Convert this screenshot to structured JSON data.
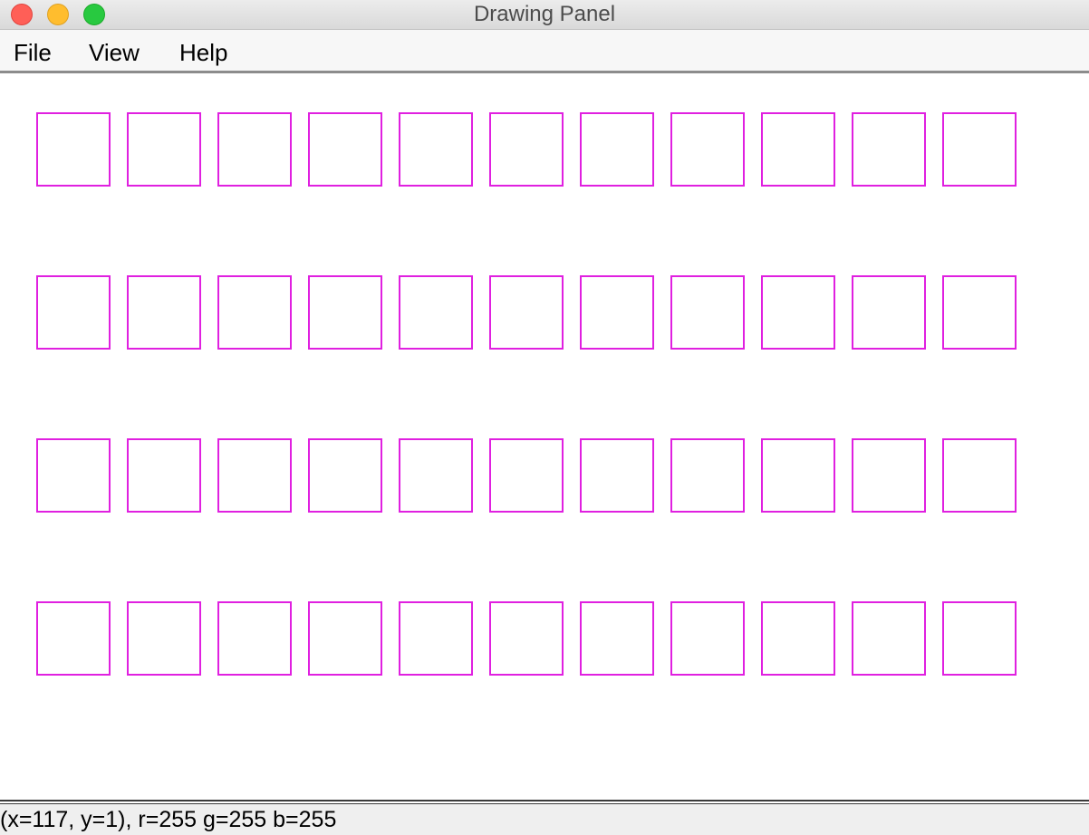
{
  "window": {
    "title": "Drawing Panel"
  },
  "menu": [
    {
      "label": "File"
    },
    {
      "label": "View"
    },
    {
      "label": "Help"
    }
  ],
  "canvas": {
    "background": "#ffffff",
    "shape": "square-outline",
    "stroke_color": "#e020e0",
    "rows": 4,
    "columns": 11
  },
  "status": {
    "text": "(x=117, y=1), r=255 g=255 b=255"
  },
  "colors": {
    "close": "#ff5f57",
    "minimize": "#ffbd2e",
    "zoom": "#28c940"
  }
}
